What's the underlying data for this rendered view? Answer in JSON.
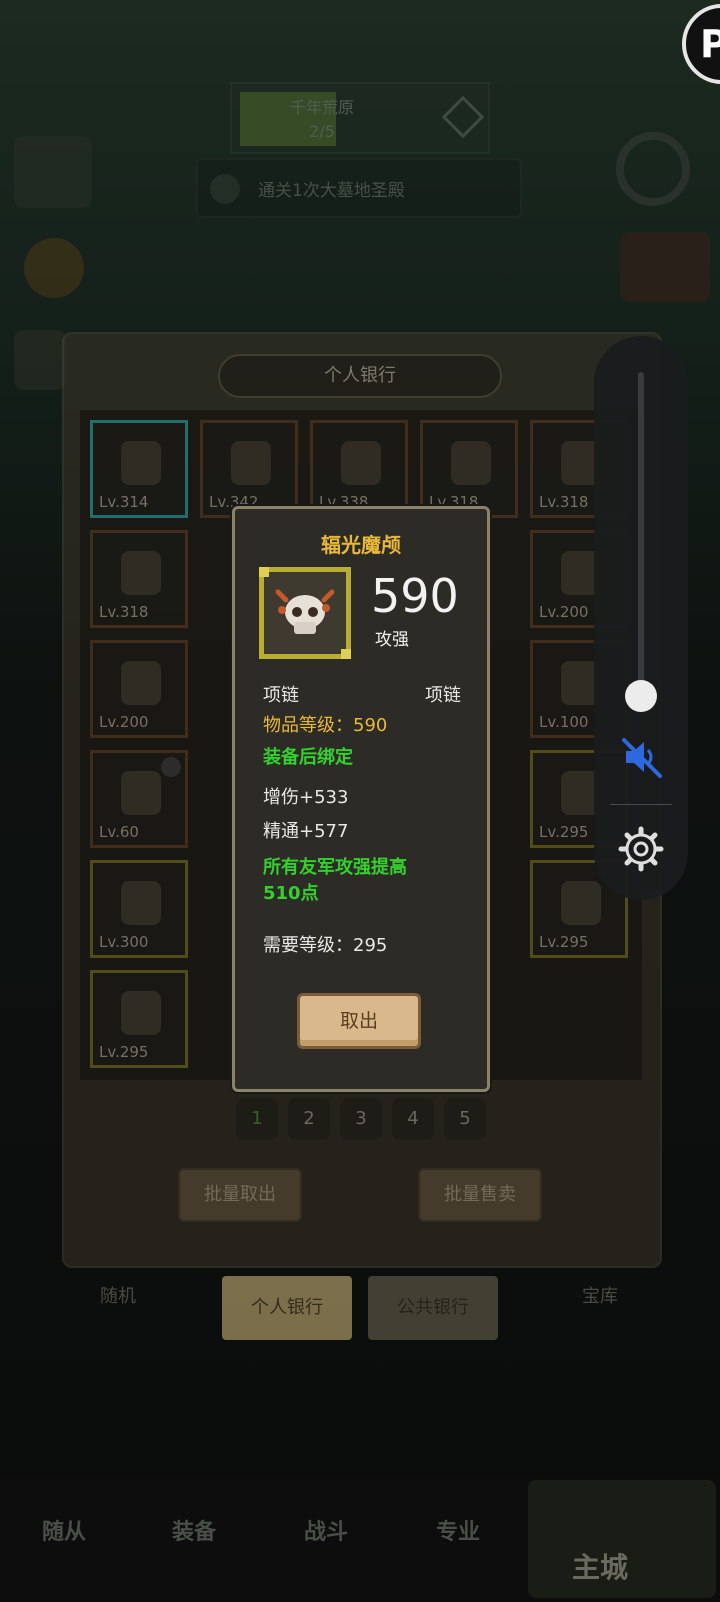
{
  "quest": {
    "title": "千年荒原",
    "progress": "2/5",
    "task": "通关1次大墓地圣殿"
  },
  "bank": {
    "title": "个人银行",
    "slots": [
      {
        "level": "Lv.314"
      },
      {
        "level": "Lv.342"
      },
      {
        "level": "Lv.338"
      },
      {
        "level": "Lv.318"
      },
      {
        "level": "Lv.318"
      },
      {
        "level": "Lv.318"
      },
      {
        "level": "Lv.200"
      },
      {
        "level": "Lv.200"
      },
      {
        "level": "Lv.100"
      },
      {
        "level": "Lv.60"
      },
      {
        "level": "Lv.295"
      },
      {
        "level": "Lv.300"
      },
      {
        "level": "Lv.295"
      },
      {
        "level": "Lv.295"
      }
    ],
    "pages": [
      "1",
      "2",
      "3",
      "4",
      "5"
    ],
    "batch_take": "批量取出",
    "batch_sell": "批量售卖",
    "tab_personal": "个人银行",
    "tab_public": "公共银行",
    "left_faded": "随机",
    "right_faded": "宝库"
  },
  "tooltip": {
    "item_name": "辐光魔颅",
    "power": "590",
    "power_label": "攻强",
    "slot_type": "项链",
    "item_category": "项链",
    "item_level": "物品等级：590",
    "bind_note": "装备后绑定",
    "stat_1": "增伤+533",
    "stat_2": "精通+577",
    "effect_line1": "所有友军攻强提高",
    "effect_line2": "510点",
    "required_level": "需要等级：295",
    "take_out": "取出"
  },
  "bottom_nav": {
    "items": [
      "随从",
      "装备",
      "战斗",
      "专业"
    ],
    "home": "主城"
  },
  "overlay": {
    "badge_letter": "P"
  }
}
